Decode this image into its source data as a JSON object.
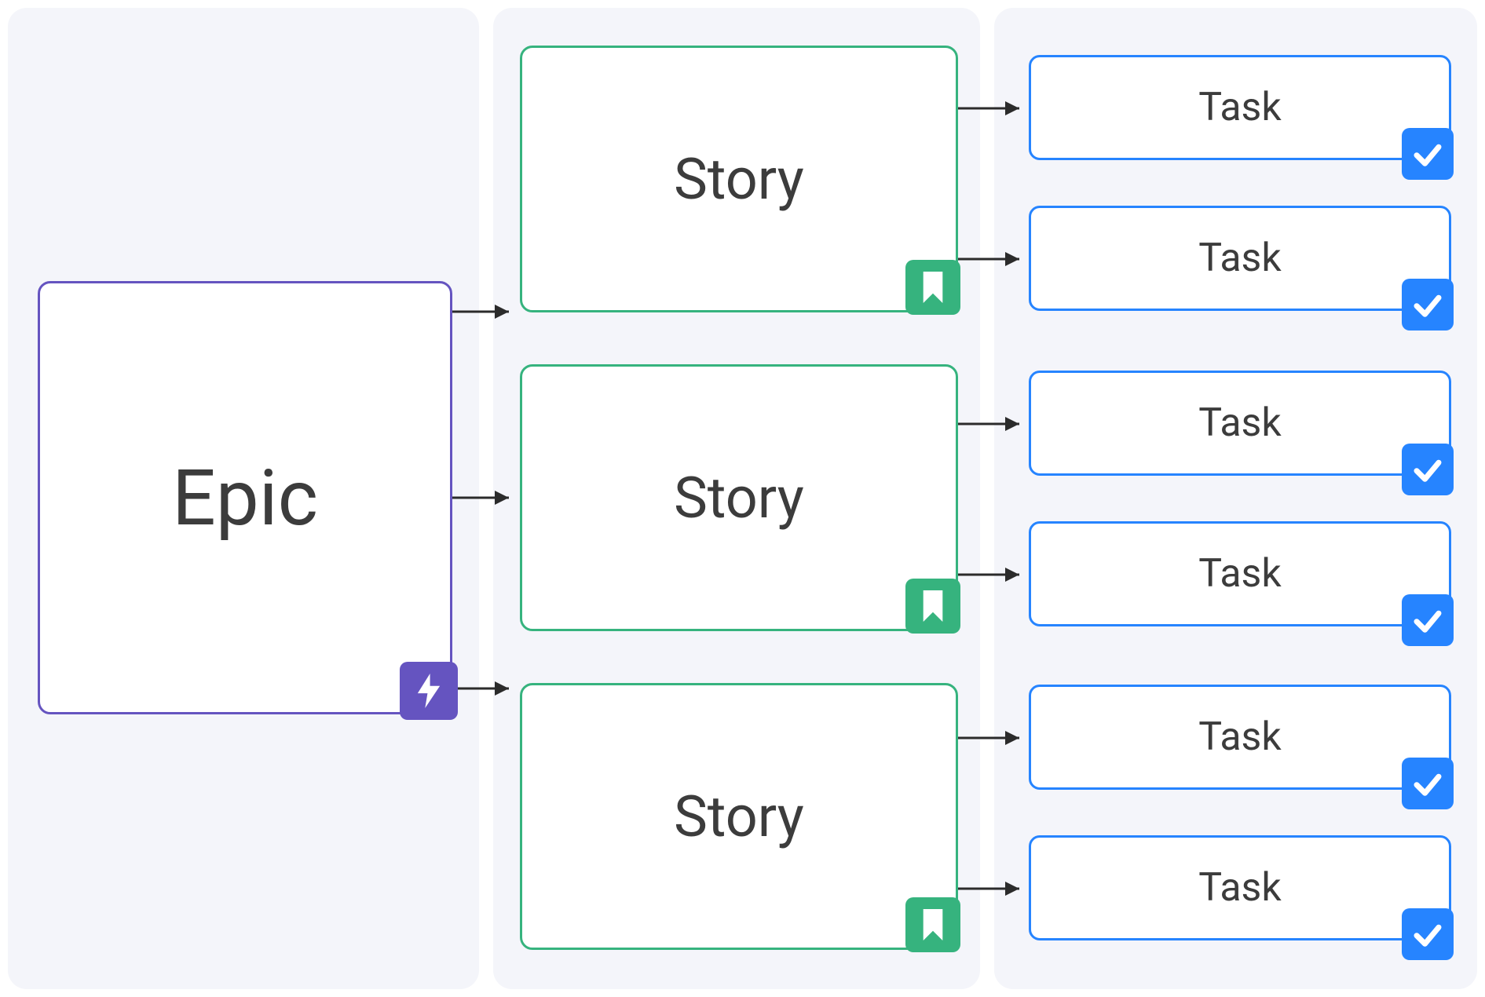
{
  "colors": {
    "panel_bg": "#F4F5FA",
    "epic": "#6554C0",
    "story": "#36B37E",
    "task": "#2684FF",
    "text": "#3c3c3c",
    "arrow": "#2b2b2b"
  },
  "epic": {
    "label": "Epic",
    "icon": "lightning-icon"
  },
  "stories": [
    {
      "label": "Story",
      "icon": "bookmark-icon"
    },
    {
      "label": "Story",
      "icon": "bookmark-icon"
    },
    {
      "label": "Story",
      "icon": "bookmark-icon"
    }
  ],
  "tasks": [
    {
      "label": "Task",
      "icon": "check-icon"
    },
    {
      "label": "Task",
      "icon": "check-icon"
    },
    {
      "label": "Task",
      "icon": "check-icon"
    },
    {
      "label": "Task",
      "icon": "check-icon"
    },
    {
      "label": "Task",
      "icon": "check-icon"
    },
    {
      "label": "Task",
      "icon": "check-icon"
    }
  ]
}
